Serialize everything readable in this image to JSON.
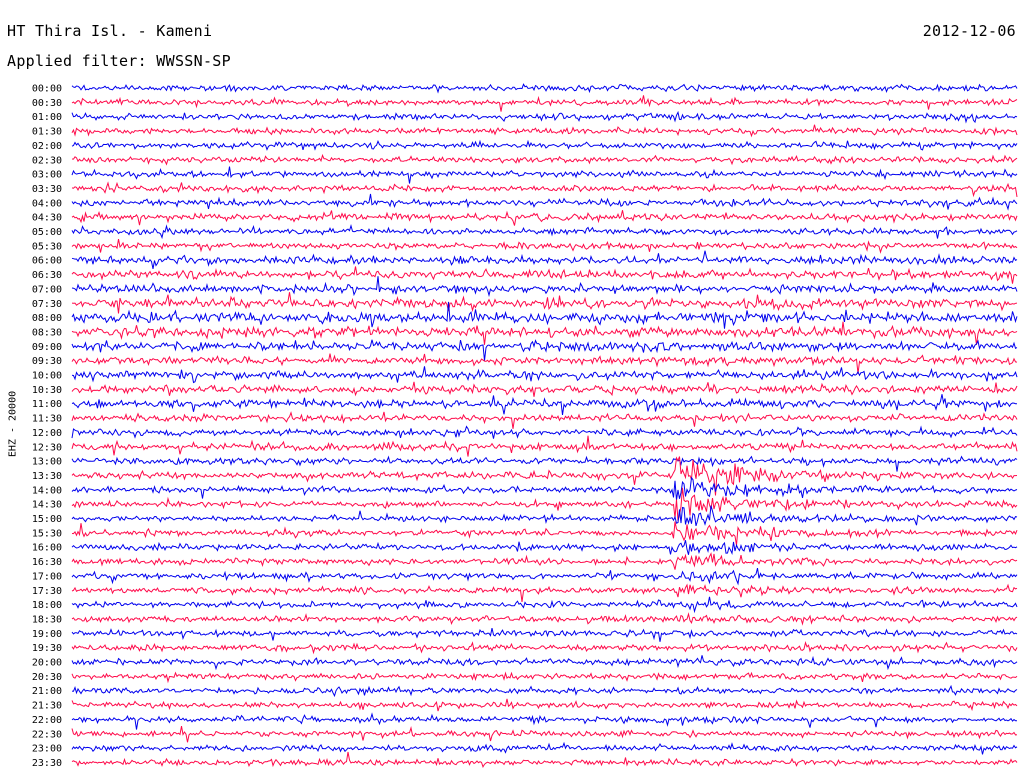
{
  "header": {
    "station": "HT Thira Isl. - Kameni",
    "date": "2012-12-06",
    "filter": "Applied filter: WWSSN-SP"
  },
  "chart_data": {
    "type": "line",
    "title": "HT Thira Isl. - Kameni",
    "ylabel": "EHZ - 20000",
    "row_labels": [
      "00:00",
      "00:30",
      "01:00",
      "01:30",
      "02:00",
      "02:30",
      "03:00",
      "03:30",
      "04:00",
      "04:30",
      "05:00",
      "05:30",
      "06:00",
      "06:30",
      "07:00",
      "07:30",
      "08:00",
      "08:30",
      "09:00",
      "09:30",
      "10:00",
      "10:30",
      "11:00",
      "11:30",
      "12:00",
      "12:30",
      "13:00",
      "13:30",
      "14:00",
      "14:30",
      "15:00",
      "15:30",
      "16:00",
      "16:30",
      "17:00",
      "17:30",
      "18:00",
      "18:30",
      "19:00",
      "19:30",
      "20:00",
      "20:30",
      "21:00",
      "21:30",
      "22:00",
      "22:30",
      "23:00",
      "23:30"
    ],
    "trace_colors": [
      "#0000ee",
      "#ff0a4a"
    ],
    "background": "#ffffff",
    "relative_amplitude": [
      3,
      3,
      3,
      3,
      3,
      3,
      3,
      3,
      3.5,
      3.5,
      3,
      3,
      4,
      4,
      4,
      5,
      5,
      5,
      4.5,
      4,
      4,
      4,
      4,
      3.5,
      3.5,
      3.5,
      3.5,
      3.5,
      3,
      3,
      3,
      3,
      3,
      3,
      3,
      3,
      3,
      3,
      3,
      3,
      3,
      3,
      3,
      3,
      3,
      3,
      3,
      3
    ],
    "events": [
      {
        "label": "13:30",
        "onset_fraction_of_row": 0.635,
        "duration_rows": 14,
        "peak_relative_amplitude": 18
      }
    ]
  }
}
